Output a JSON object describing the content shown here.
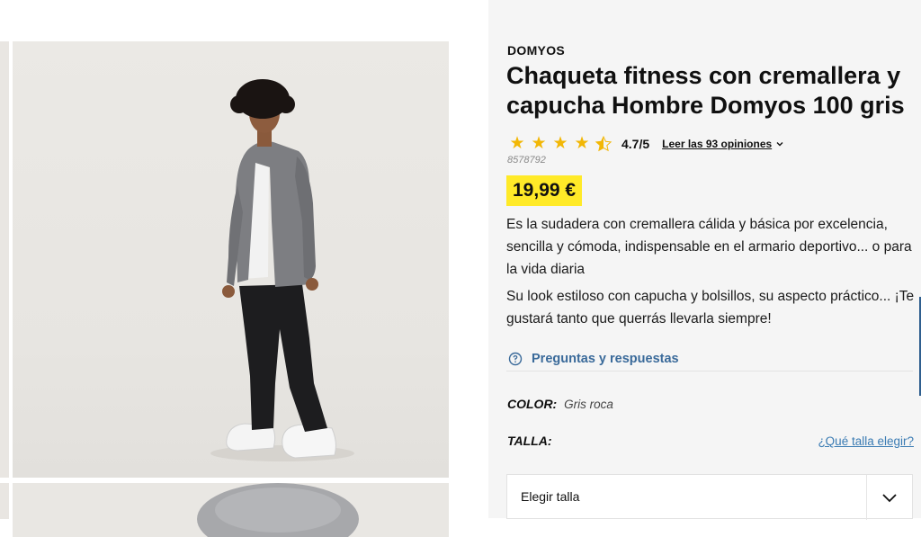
{
  "product": {
    "brand": "DOMYOS",
    "title": "Chaqueta fitness con cremallera y capucha Hombre Domyos 100 gris",
    "rating": "4.7/5",
    "stars": 4.5,
    "reviews_link": "Leer las 93 opiniones",
    "reference": "8578792",
    "price": "19,99 €",
    "description_1": "Es la sudadera con cremallera cálida y básica por excelencia, sencilla y cómoda, indispensable en el armario deportivo... o para la vida diaria",
    "description_2": "Su look estiloso con capucha y bolsillos, su aspecto práctico... ¡Te gustará tanto que querrás llevarla siempre!"
  },
  "qa": {
    "label": "Preguntas y respuestas"
  },
  "color": {
    "label": "COLOR:",
    "value": "Gris roca"
  },
  "size": {
    "label": "TALLA:",
    "guide_link": "¿Qué talla elegir?",
    "select_placeholder": "Elegir talla"
  },
  "colors": {
    "price_bg": "#ffea28",
    "star": "#f2b705",
    "link_blue": "#3a6a9a"
  }
}
